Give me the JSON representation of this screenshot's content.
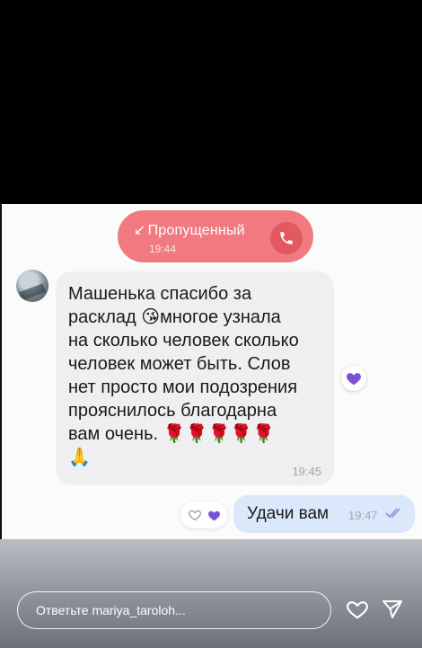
{
  "missed_call": {
    "label": "Пропущенный",
    "arrow_icon": "↙",
    "time": "19:44"
  },
  "incoming_message": {
    "text": "Машенька спасибо за\nрасклад 😘многое узнала\nна сколько человек сколько\nчеловек может быть. Слов\nнет просто мои подозрения\nпрояснилось благодарна\nвам очень. 🌹🌹🌹🌹🌹\n🙏",
    "time": "19:45"
  },
  "outgoing_message": {
    "text": "Удачи вам",
    "time": "19:47"
  },
  "reply_bar": {
    "placeholder": "Ответьте mariya_taroloh..."
  },
  "colors": {
    "missed_call_bg": "#f07a7f",
    "outgoing_bg": "#dbe8fc",
    "heart_purple": "#7b52d6"
  }
}
